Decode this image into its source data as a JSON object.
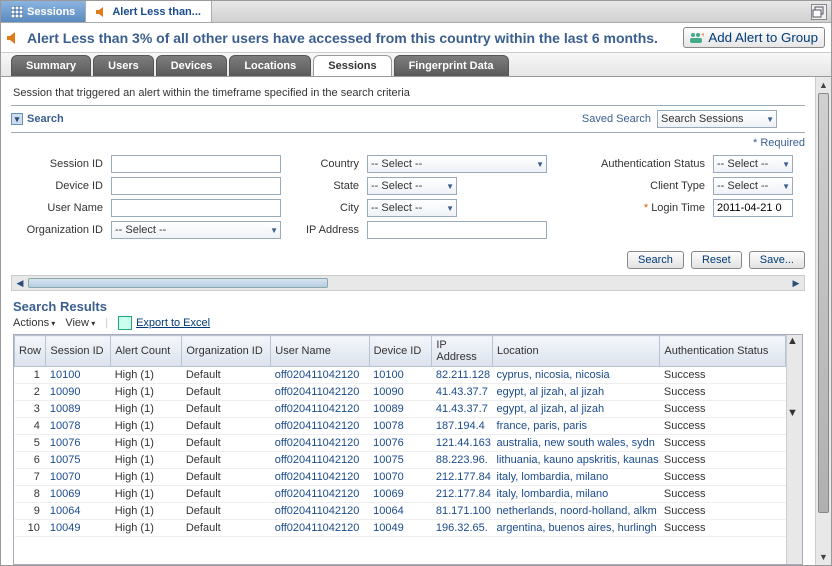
{
  "topTabs": {
    "sessions": "Sessions",
    "alert": "Alert Less than..."
  },
  "alertMessage": "Alert Less than 3% of all other users have accessed from this country within the last 6 months.",
  "addAlertBtn": "Add Alert to Group",
  "navTabs": [
    "Summary",
    "Users",
    "Devices",
    "Locations",
    "Sessions",
    "Fingerprint Data"
  ],
  "activeNavTab": "Sessions",
  "description": "Session that triggered an alert within the timeframe specified in the search criteria",
  "searchTitle": "Search",
  "savedSearchLabel": "Saved Search",
  "savedSearchValue": "Search Sessions",
  "requiredNote": "* Required",
  "labels": {
    "sessionId": "Session ID",
    "deviceId": "Device ID",
    "userName": "User Name",
    "orgId": "Organization ID",
    "country": "Country",
    "state": "State",
    "city": "City",
    "ipAddress": "IP Address",
    "authStatus": "Authentication Status",
    "clientType": "Client Type",
    "loginTime": "Login Time"
  },
  "selectPlaceholder": "-- Select --",
  "loginTimeValue": "2011-04-21 0",
  "buttons": {
    "search": "Search",
    "reset": "Reset",
    "save": "Save..."
  },
  "resultsTitle": "Search Results",
  "toolbar": {
    "actions": "Actions",
    "view": "View",
    "export": "Export to Excel"
  },
  "columns": [
    "Row",
    "Session ID",
    "Alert Count",
    "Organization ID",
    "User Name",
    "Device ID",
    "IP Address",
    "Location",
    "Authentication Status"
  ],
  "rows": [
    {
      "row": 1,
      "sid": "10100",
      "alert": "High (1)",
      "org": "Default",
      "user": "off020411042120",
      "dev": "10100",
      "ip": "82.211.128",
      "loc": "cyprus, nicosia, nicosia",
      "auth": "Success"
    },
    {
      "row": 2,
      "sid": "10090",
      "alert": "High (1)",
      "org": "Default",
      "user": "off020411042120",
      "dev": "10090",
      "ip": "41.43.37.7",
      "loc": "egypt, al jizah, al jizah",
      "auth": "Success"
    },
    {
      "row": 3,
      "sid": "10089",
      "alert": "High (1)",
      "org": "Default",
      "user": "off020411042120",
      "dev": "10089",
      "ip": "41.43.37.7",
      "loc": "egypt, al jizah, al jizah",
      "auth": "Success"
    },
    {
      "row": 4,
      "sid": "10078",
      "alert": "High (1)",
      "org": "Default",
      "user": "off020411042120",
      "dev": "10078",
      "ip": "187.194.4",
      "loc": "france, paris, paris",
      "auth": "Success"
    },
    {
      "row": 5,
      "sid": "10076",
      "alert": "High (1)",
      "org": "Default",
      "user": "off020411042120",
      "dev": "10076",
      "ip": "121.44.163",
      "loc": "australia, new south wales, sydn",
      "auth": "Success"
    },
    {
      "row": 6,
      "sid": "10075",
      "alert": "High (1)",
      "org": "Default",
      "user": "off020411042120",
      "dev": "10075",
      "ip": "88.223.96.",
      "loc": "lithuania, kauno apskritis, kaunas",
      "auth": "Success"
    },
    {
      "row": 7,
      "sid": "10070",
      "alert": "High (1)",
      "org": "Default",
      "user": "off020411042120",
      "dev": "10070",
      "ip": "212.177.84",
      "loc": "italy, lombardia, milano",
      "auth": "Success"
    },
    {
      "row": 8,
      "sid": "10069",
      "alert": "High (1)",
      "org": "Default",
      "user": "off020411042120",
      "dev": "10069",
      "ip": "212.177.84",
      "loc": "italy, lombardia, milano",
      "auth": "Success"
    },
    {
      "row": 9,
      "sid": "10064",
      "alert": "High (1)",
      "org": "Default",
      "user": "off020411042120",
      "dev": "10064",
      "ip": "81.171.100",
      "loc": "netherlands, noord-holland, alkm",
      "auth": "Success"
    },
    {
      "row": 10,
      "sid": "10049",
      "alert": "High (1)",
      "org": "Default",
      "user": "off020411042120",
      "dev": "10049",
      "ip": "196.32.65.",
      "loc": "argentina, buenos aires, hurlingh",
      "auth": "Success"
    }
  ]
}
